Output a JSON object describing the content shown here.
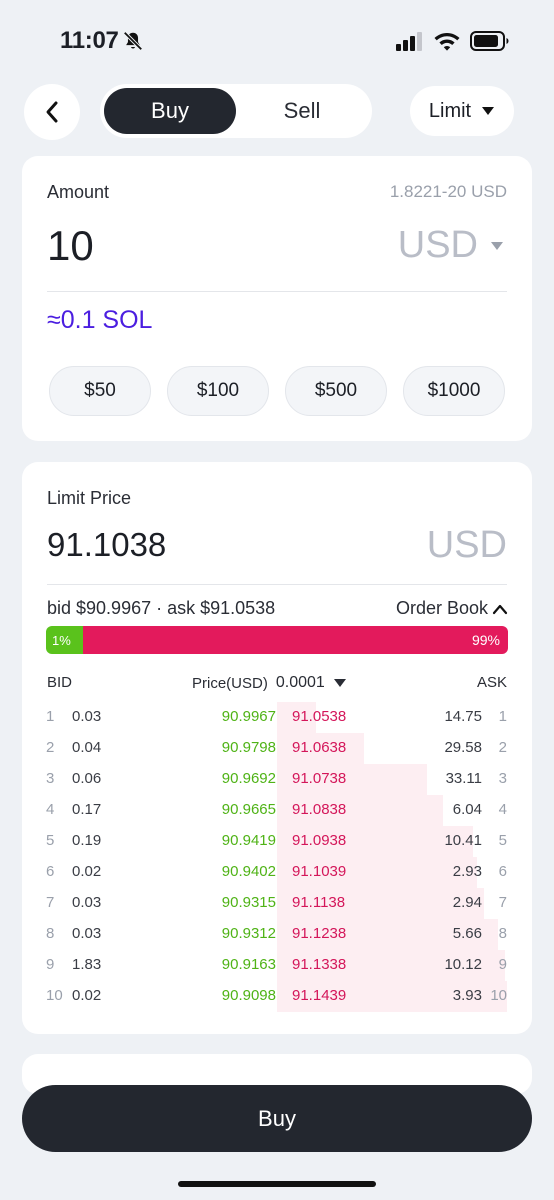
{
  "status": {
    "time": "11:07",
    "icons": [
      "bell-slash-icon",
      "signal-icon",
      "wifi-icon",
      "battery-icon"
    ]
  },
  "nav": {
    "back_icon": "chevron-left-icon",
    "tabs": [
      {
        "label": "Buy",
        "active": true
      },
      {
        "label": "Sell",
        "active": false
      }
    ],
    "order_type": "Limit"
  },
  "amount": {
    "label": "Amount",
    "range": "1.8221-20 USD",
    "value": "10",
    "unit": "USD",
    "approx": "≈0.1 SOL",
    "quick": [
      "$50",
      "$100",
      "$500",
      "$1000"
    ]
  },
  "limit": {
    "label": "Limit Price",
    "value": "91.1038",
    "unit": "USD",
    "bid_ask": "bid $90.9967 · ask $91.0538",
    "orderbook_label": "Order Book",
    "bid_pct_label": "1%",
    "ask_pct_label": "99%",
    "bid_fraction": 0.01,
    "ask_fraction": 0.99
  },
  "orderbook": {
    "headers": {
      "bid": "BID",
      "price": "Price(USD)",
      "tick": "0.0001",
      "ask": "ASK"
    },
    "rows": [
      {
        "i": "1",
        "bid_size": "0.03",
        "bid_price": "90.9967",
        "ask_price": "91.0538",
        "ask_size": "14.75",
        "depth": 0.17
      },
      {
        "i": "2",
        "bid_size": "0.04",
        "bid_price": "90.9798",
        "ask_price": "91.0638",
        "ask_size": "29.58",
        "depth": 0.38
      },
      {
        "i": "3",
        "bid_size": "0.06",
        "bid_price": "90.9692",
        "ask_price": "91.0738",
        "ask_size": "33.11",
        "depth": 0.65
      },
      {
        "i": "4",
        "bid_size": "0.17",
        "bid_price": "90.9665",
        "ask_price": "91.0838",
        "ask_size": "6.04",
        "depth": 0.72
      },
      {
        "i": "5",
        "bid_size": "0.19",
        "bid_price": "90.9419",
        "ask_price": "91.0938",
        "ask_size": "10.41",
        "depth": 0.85
      },
      {
        "i": "6",
        "bid_size": "0.02",
        "bid_price": "90.9402",
        "ask_price": "91.1039",
        "ask_size": "2.93",
        "depth": 0.87
      },
      {
        "i": "7",
        "bid_size": "0.03",
        "bid_price": "90.9315",
        "ask_price": "91.1138",
        "ask_size": "2.94",
        "depth": 0.9
      },
      {
        "i": "8",
        "bid_size": "0.03",
        "bid_price": "90.9312",
        "ask_price": "91.1238",
        "ask_size": "5.66",
        "depth": 0.96
      },
      {
        "i": "9",
        "bid_size": "1.83",
        "bid_price": "90.9163",
        "ask_price": "91.1338",
        "ask_size": "10.12",
        "depth": 0.99
      },
      {
        "i": "10",
        "bid_size": "0.02",
        "bid_price": "90.9098",
        "ask_price": "91.1439",
        "ask_size": "3.93",
        "depth": 1.0
      }
    ]
  },
  "footer": {
    "buy_label": "Buy"
  },
  "colors": {
    "accent": "#23272f",
    "bid": "#5ac21c",
    "ask": "#e31a5c",
    "approx": "#4b1ee0"
  }
}
